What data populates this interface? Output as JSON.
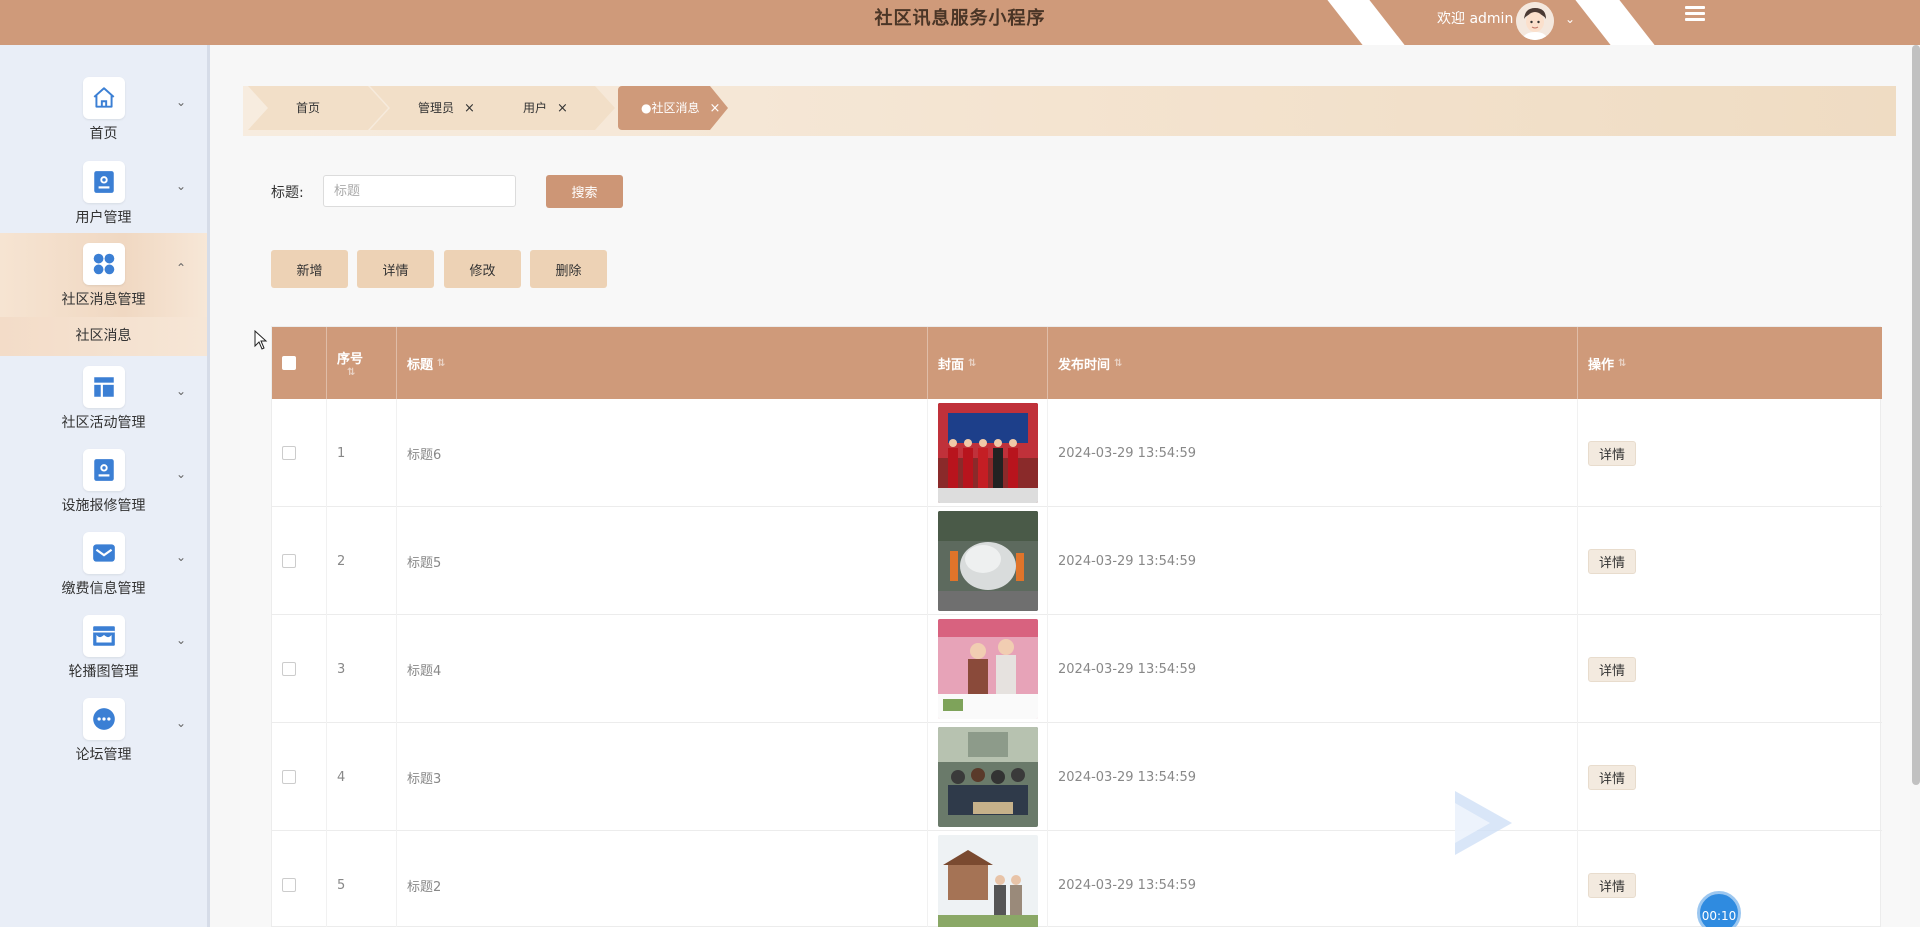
{
  "header": {
    "app_title": "社区讯息服务小程序",
    "welcome_text": "欢迎 admin",
    "colors": {
      "header_bg": "#cf9a7a",
      "accent": "#cd9676"
    }
  },
  "sidebar": {
    "items": [
      {
        "label": "首页",
        "icon": "home-icon"
      },
      {
        "label": "用户管理",
        "icon": "user-card-icon"
      },
      {
        "label": "社区消息管理",
        "icon": "grid-icon",
        "expanded": true,
        "children": [
          {
            "label": "社区消息"
          }
        ]
      },
      {
        "label": "社区活动管理",
        "icon": "layout-icon"
      },
      {
        "label": "设施报修管理",
        "icon": "user-card-icon"
      },
      {
        "label": "缴费信息管理",
        "icon": "mail-icon"
      },
      {
        "label": "轮播图管理",
        "icon": "store-icon"
      },
      {
        "label": "论坛管理",
        "icon": "chat-icon"
      }
    ]
  },
  "tabs": [
    {
      "label": "首页",
      "closable": false
    },
    {
      "label": "管理员",
      "closable": true
    },
    {
      "label": "用户",
      "closable": true
    },
    {
      "label": "●社区消息",
      "closable": true,
      "active": true
    }
  ],
  "close_glyph": "×",
  "search": {
    "label": "标题:",
    "placeholder": "标题",
    "button": "搜索"
  },
  "actions": {
    "add": "新增",
    "detail": "详情",
    "edit": "修改",
    "delete": "删除"
  },
  "table": {
    "columns": [
      "序号",
      "标题",
      "封面",
      "发布时间",
      "操作"
    ],
    "rows": [
      {
        "index": "1",
        "title": "标题6",
        "time": "2024-03-29 13:54:59",
        "op": "详情"
      },
      {
        "index": "2",
        "title": "标题5",
        "time": "2024-03-29 13:54:59",
        "op": "详情"
      },
      {
        "index": "3",
        "title": "标题4",
        "time": "2024-03-29 13:54:59",
        "op": "详情"
      },
      {
        "index": "4",
        "title": "标题3",
        "time": "2024-03-29 13:54:59",
        "op": "详情"
      },
      {
        "index": "5",
        "title": "标题2",
        "time": "2024-03-29 13:54:59",
        "op": "详情"
      }
    ]
  },
  "timer": "00:10"
}
